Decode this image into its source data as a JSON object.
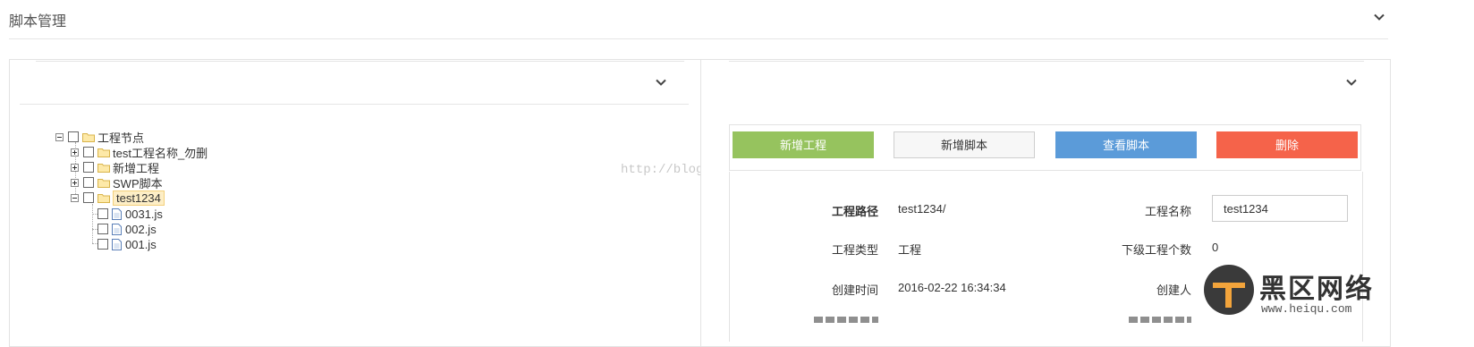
{
  "page": {
    "title": "脚本管理"
  },
  "watermark": "http://blog.csdn.net/",
  "tree": {
    "root": "工程节点",
    "children": [
      {
        "label": "test工程名称_勿删",
        "state": "collapsed"
      },
      {
        "label": "新增工程",
        "state": "collapsed"
      },
      {
        "label": "SWP脚本",
        "state": "collapsed"
      },
      {
        "label": "test1234",
        "state": "expanded",
        "files": [
          "0031.js",
          "002.js",
          "001.js"
        ]
      }
    ]
  },
  "actions": {
    "add_project": "新增工程",
    "add_script": "新增脚本",
    "view_script": "查看脚本",
    "delete": "删除"
  },
  "details": {
    "path_label": "工程路径",
    "path_value": "test1234/",
    "name_label": "工程名称",
    "name_value": "test1234",
    "type_label": "工程类型",
    "type_value": "工程",
    "sub_count_label": "下级工程个数",
    "sub_count_value": "0",
    "created_label": "创建时间",
    "created_value": "2016-02-22 16:34:34",
    "creator_label": "创建人"
  },
  "logo": {
    "text": "黑区网络",
    "sub": "www.heiqu.com"
  },
  "colors": {
    "green": "#96c35e",
    "blue": "#5b9bd9",
    "red": "#f5634a"
  }
}
